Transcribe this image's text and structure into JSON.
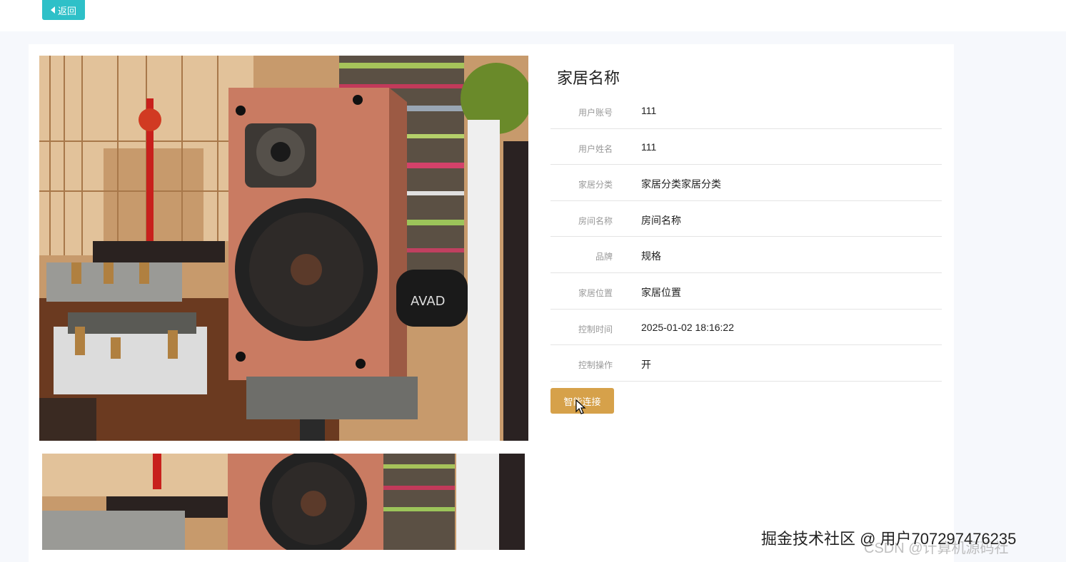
{
  "header": {
    "back_label": "返回"
  },
  "detail": {
    "title": "家居名称",
    "rows": [
      {
        "label": "用户账号",
        "value": "111"
      },
      {
        "label": "用户姓名",
        "value": "111"
      },
      {
        "label": "家居分类",
        "value": "家居分类家居分类"
      },
      {
        "label": "房间名称",
        "value": "房间名称"
      },
      {
        "label": "品牌",
        "value": "规格"
      },
      {
        "label": "家居位置",
        "value": "家居位置"
      },
      {
        "label": "控制时间",
        "value": "2025-01-02 18:16:22"
      },
      {
        "label": "控制操作",
        "value": "开"
      }
    ],
    "connect_label": "智能连接"
  },
  "images": {
    "main_alt": "speaker",
    "thumb_alt": "speaker"
  },
  "watermark": {
    "text": "掘金技术社区 @ 用户707297476235",
    "secondary": "CSDN @计算机源码社"
  },
  "colors": {
    "back_button": "#2ec0c8",
    "connect_button": "#d6a14a"
  }
}
